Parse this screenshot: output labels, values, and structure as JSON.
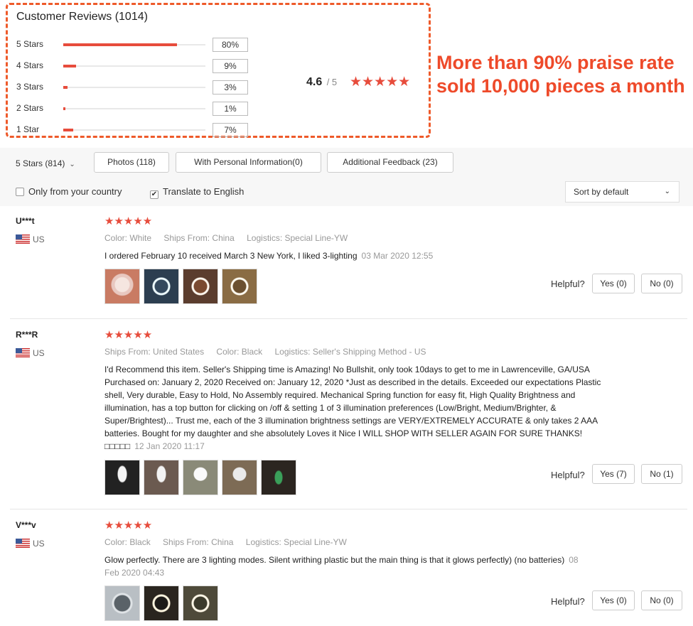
{
  "summary": {
    "title": "Customer Reviews (1014)",
    "distribution": [
      {
        "label": "5 Stars",
        "percent": "80%",
        "fill": 0.8
      },
      {
        "label": "4 Stars",
        "percent": "9%",
        "fill": 0.09
      },
      {
        "label": "3 Stars",
        "percent": "3%",
        "fill": 0.03
      },
      {
        "label": "2 Stars",
        "percent": "1%",
        "fill": 0.01
      },
      {
        "label": "1 Star",
        "percent": "7%",
        "fill": 0.07
      }
    ],
    "average": "4.6",
    "out_of": "/ 5",
    "stars": "★★★★★"
  },
  "promo": {
    "line1": "More than 90% praise rate",
    "line2": "sold 10,000 pieces a month"
  },
  "filters": {
    "star_select": "5 Stars (814)",
    "photos": "Photos (118)",
    "personal": "With Personal Information(0)",
    "additional": "Additional Feedback (23)",
    "only_country": "Only from your country",
    "translate": "Translate to English",
    "sort": "Sort by default"
  },
  "helpful_label": "Helpful?",
  "reviews": [
    {
      "user": "U***t",
      "country": "US",
      "stars": "★★★★★",
      "meta": [
        {
          "k": "Color:",
          "v": "White"
        },
        {
          "k": "Ships From:",
          "v": "China"
        },
        {
          "k": "Logistics:",
          "v": "Special Line-YW"
        }
      ],
      "text": "I ordered February 10 received March 3 New York, I liked 3-lighting",
      "date": "03 Mar 2020 12:55",
      "yes": "Yes (0)",
      "no": "No (0)"
    },
    {
      "user": "R***R",
      "country": "US",
      "stars": "★★★★★",
      "meta": [
        {
          "k": "Ships From:",
          "v": "United States"
        },
        {
          "k": "Color:",
          "v": "Black"
        },
        {
          "k": "Logistics:",
          "v": "Seller's Shipping Method - US"
        }
      ],
      "text": "I'd Recommend this item. Seller's Shipping time is Amazing! No Bullshit, only took 10days to get to me in Lawrenceville, GA/USA Purchased on: January 2, 2020 Received on: January 12, 2020 *Just as described in the details. Exceeded our expectations Plastic shell, Very durable, Easy to Hold, No Assembly required. Mechanical Spring function for easy fit, High Quality Brightness and illumination, has a top button for clicking on /off & setting 1 of 3 illumination preferences (Low/Bright, Medium/Brighter, & Super/Brightest)... Trust me, each of the 3 illumination brightness settings are VERY/EXTREMELY ACCURATE & only takes 2 AAA batteries. Bought for my daughter and she absolutely Loves it Nice I WILL SHOP WITH SELLER AGAIN FOR SURE THANKS!□□□□□",
      "date": "12 Jan 2020 11:17",
      "yes": "Yes (7)",
      "no": "No (1)"
    },
    {
      "user": "V***v",
      "country": "US",
      "stars": "★★★★★",
      "meta": [
        {
          "k": "Color:",
          "v": "Black"
        },
        {
          "k": "Ships From:",
          "v": "China"
        },
        {
          "k": "Logistics:",
          "v": "Special Line-YW"
        }
      ],
      "text": "Glow perfectly. There are 3 lighting modes. Silent writhing plastic but the main thing is that it glows perfectly) (no batteries)",
      "date": "08 Feb 2020 04:43",
      "yes": "Yes (0)",
      "no": "No (0)"
    }
  ]
}
